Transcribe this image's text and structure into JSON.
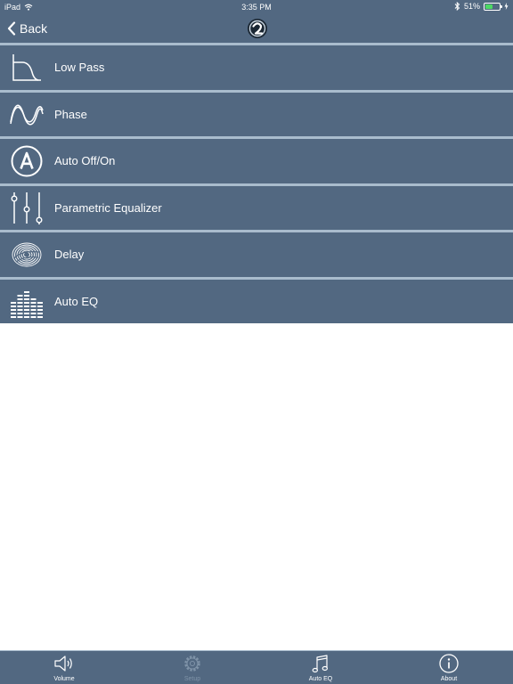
{
  "status_bar": {
    "device": "iPad",
    "time": "3:35 PM",
    "battery_percent": "51%",
    "battery_level": 0.51,
    "wifi_icon": "wifi-icon",
    "bluetooth_icon": "bluetooth-icon"
  },
  "nav": {
    "back_label": "Back",
    "logo_icon": "app-logo-icon"
  },
  "menu": {
    "items": [
      {
        "label": "Low Pass",
        "icon": "low-pass-filter-icon"
      },
      {
        "label": "Phase",
        "icon": "sine-wave-icon"
      },
      {
        "label": "Auto Off/On",
        "icon": "circle-a-icon"
      },
      {
        "label": "Parametric Equalizer",
        "icon": "sliders-icon"
      },
      {
        "label": "Delay",
        "icon": "fingerprint-icon"
      },
      {
        "label": "Auto EQ",
        "icon": "eq-bars-icon"
      }
    ]
  },
  "tabs": [
    {
      "label": "Volume",
      "icon": "speaker-icon",
      "active": true
    },
    {
      "label": "Setup",
      "icon": "gear-icon",
      "active": false
    },
    {
      "label": "Auto EQ",
      "icon": "music-note-icon",
      "active": true
    },
    {
      "label": "About",
      "icon": "info-icon",
      "active": true
    }
  ],
  "colors": {
    "bar_background": "#526881",
    "separator": "#a9bccd",
    "text": "#ffffff",
    "inactive_tab": "#7f93a8",
    "battery_fill": "#4cd964"
  }
}
